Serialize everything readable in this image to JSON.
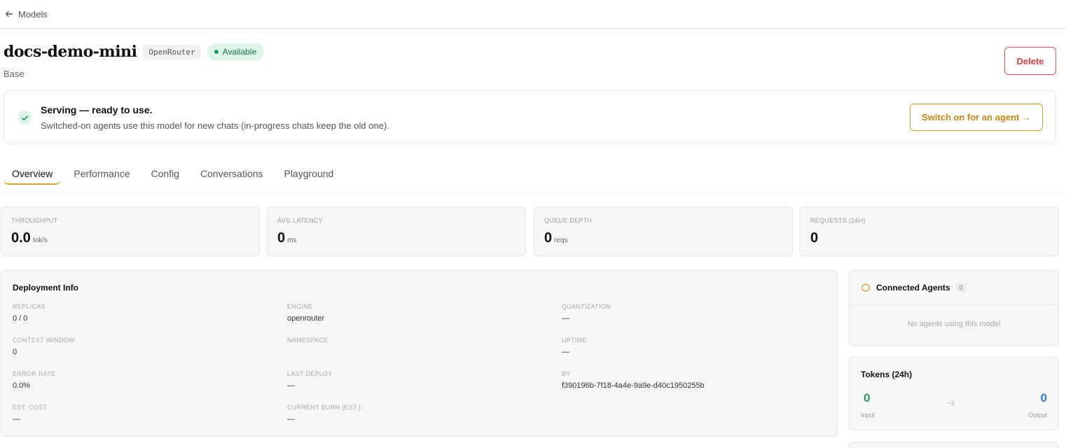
{
  "nav": {
    "back_label": "Models"
  },
  "model": {
    "name": "docs-demo-mini",
    "provider": "OpenRouter",
    "status": "Available",
    "subtitle": "Base",
    "delete_label": "Delete"
  },
  "serving": {
    "title": "Serving — ready to use.",
    "description": "Switched-on agents use this model for new chats (in-progress chats keep the old one).",
    "button_label": "Switch on for an agent →"
  },
  "tabs": [
    {
      "label": "Overview",
      "active": true
    },
    {
      "label": "Performance",
      "active": false
    },
    {
      "label": "Config",
      "active": false
    },
    {
      "label": "Conversations",
      "active": false
    },
    {
      "label": "Playground",
      "active": false
    }
  ],
  "stats": [
    {
      "label": "THROUGHPUT",
      "value": "0.0",
      "unit": "tok/s"
    },
    {
      "label": "AVG LATENCY",
      "value": "0",
      "unit": "ms"
    },
    {
      "label": "QUEUE DEPTH",
      "value": "0",
      "unit": "reqs"
    },
    {
      "label": "REQUESTS (24H)",
      "value": "0",
      "unit": ""
    }
  ],
  "deployment": {
    "title": "Deployment Info",
    "fields": [
      {
        "label": "REPLICAS",
        "value": "0 / 0"
      },
      {
        "label": "ENGINE",
        "value": "openrouter"
      },
      {
        "label": "QUANTIZATION",
        "value": "—"
      },
      {
        "label": "CONTEXT WINDOW",
        "value": "0"
      },
      {
        "label": "NAMESPACE",
        "value": ""
      },
      {
        "label": "UPTIME",
        "value": "—"
      },
      {
        "label": "ERROR RATE",
        "value": "0.0%"
      },
      {
        "label": "LAST DEPLOY",
        "value": "—"
      },
      {
        "label": "BY",
        "value": "f390196b-7f18-4a4e-9a9e-d40c1950255b"
      },
      {
        "label": "EST. COST",
        "value": "—"
      },
      {
        "label": "CURRENT BURN (EST.)",
        "value": "—"
      }
    ]
  },
  "agents": {
    "title": "Connected Agents",
    "count": "0",
    "empty_text": "No agents using this model"
  },
  "tokens": {
    "title": "Tokens (24h)",
    "input_value": "0",
    "input_label": "Input",
    "output_value": "0",
    "output_label": "Output"
  },
  "colors": {
    "accent": "#d69a1e",
    "success": "#1f9d5b",
    "danger": "#d9413f",
    "info": "#2f7be0"
  },
  "icons": {
    "back": "arrow-left-icon",
    "check": "check-icon",
    "agents": "hexagon-icon",
    "tokens_flow": "arrow-right-icon"
  }
}
